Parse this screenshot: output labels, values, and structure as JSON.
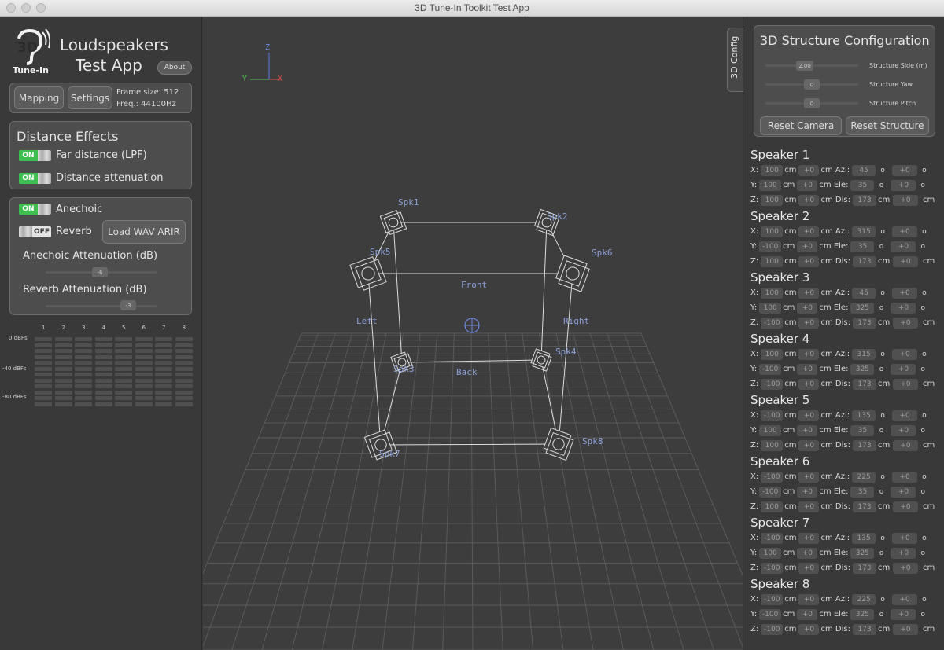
{
  "window": {
    "title": "3D Tune-In Toolkit Test App"
  },
  "logo": {
    "mark": "3D",
    "caption": "Tune-In"
  },
  "app": {
    "title_line1": "Loudspeakers",
    "title_line2": "Test App",
    "about_label": "About"
  },
  "toolbar": {
    "mapping_label": "Mapping",
    "settings_label": "Settings",
    "frame_size": "Frame size: 512",
    "freq": "Freq.: 44100Hz"
  },
  "distance": {
    "title": "Distance Effects",
    "far": {
      "state": "ON",
      "label": "Far distance (LPF)"
    },
    "attenuation": {
      "state": "ON",
      "label": "Distance attenuation"
    }
  },
  "reverb": {
    "anechoic": {
      "state": "ON",
      "label": "Anechoic"
    },
    "reverb": {
      "state": "OFF",
      "label": "Reverb"
    },
    "load_label": "Load WAV ARIR",
    "anechoic_att_label": "Anechoic Attenuation (dB)",
    "anechoic_att_value": "-6",
    "reverb_att_label": "Reverb Attenuation (dB)",
    "reverb_att_value": "-3"
  },
  "meters": {
    "channels": [
      "1",
      "2",
      "3",
      "4",
      "5",
      "6",
      "7",
      "8"
    ],
    "scale": [
      "0 dBFs",
      "-40 dBFs",
      "-80 dBFs"
    ]
  },
  "scene": {
    "axes": {
      "z": "Z",
      "y": "Y",
      "x": "X"
    },
    "speakers": [
      "Spk1",
      "Spk2",
      "Spk3",
      "Spk4",
      "Spk5",
      "Spk6",
      "Spk7",
      "Spk8"
    ],
    "faces": {
      "front": "Front",
      "back": "Back",
      "left": "Left",
      "right": "Right"
    },
    "colors": {
      "label": "#8ea0d8",
      "wire": "#dcdcdc",
      "grid": "#5a5a5a"
    }
  },
  "config_tab": {
    "label": "3D Config"
  },
  "structure": {
    "title": "3D Structure Configuration",
    "side": {
      "value": "2.00",
      "label": "Structure Side (m)"
    },
    "yaw": {
      "value": "0",
      "label": "Structure Yaw"
    },
    "pitch": {
      "value": "0",
      "label": "Structure Pitch"
    },
    "reset_camera": "Reset Camera",
    "reset_structure": "Reset Structure"
  },
  "labels": {
    "x": "X:",
    "y": "Y:",
    "z": "Z:",
    "cm": "cm",
    "azi": "cm Azi:",
    "ele": "cm Ele:",
    "dis": "cm Dis:",
    "deg": "o",
    "offset": "+0"
  },
  "speakers": [
    {
      "name": "Speaker 1",
      "x": "100",
      "y": "100",
      "z": "100",
      "azi": "45",
      "ele": "35",
      "dis": "173"
    },
    {
      "name": "Speaker 2",
      "x": "100",
      "y": "-100",
      "z": "100",
      "azi": "315",
      "ele": "35",
      "dis": "173"
    },
    {
      "name": "Speaker 3",
      "x": "100",
      "y": "100",
      "z": "-100",
      "azi": "45",
      "ele": "325",
      "dis": "173"
    },
    {
      "name": "Speaker 4",
      "x": "100",
      "y": "-100",
      "z": "-100",
      "azi": "315",
      "ele": "325",
      "dis": "173"
    },
    {
      "name": "Speaker 5",
      "x": "-100",
      "y": "100",
      "z": "100",
      "azi": "135",
      "ele": "35",
      "dis": "173"
    },
    {
      "name": "Speaker 6",
      "x": "-100",
      "y": "-100",
      "z": "100",
      "azi": "225",
      "ele": "35",
      "dis": "173"
    },
    {
      "name": "Speaker 7",
      "x": "-100",
      "y": "100",
      "z": "-100",
      "azi": "135",
      "ele": "325",
      "dis": "173"
    },
    {
      "name": "Speaker 8",
      "x": "-100",
      "y": "-100",
      "z": "-100",
      "azi": "225",
      "ele": "325",
      "dis": "173"
    }
  ]
}
